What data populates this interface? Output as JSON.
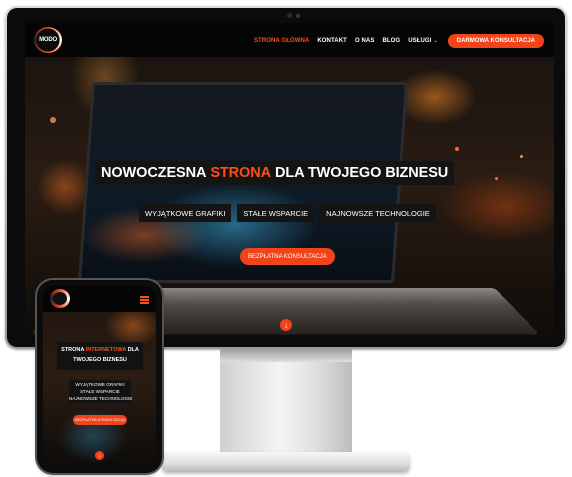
{
  "brand": {
    "logo_text": "MODO"
  },
  "nav": {
    "items": [
      {
        "label": "STRONA GŁÓWNA",
        "active": true
      },
      {
        "label": "KONTAKT"
      },
      {
        "label": "O NAS"
      },
      {
        "label": "BLOG"
      },
      {
        "label": "USŁUGI"
      }
    ],
    "cta": "DARMOWA KONSULTACJA"
  },
  "hero": {
    "title_before": "NOWOCZESNA",
    "title_accent": "STRONA",
    "title_after": "DLA TWOJEGO BIZNESU",
    "features": [
      "WYJĄTKOWE GRAFIKI",
      "STAŁE WSPARCIE",
      "NAJNOWSZE TECHNOLOGIE"
    ],
    "cta": "BEZPŁATNA KONSULTACJA"
  },
  "mobile": {
    "title_before": "STRONA",
    "title_accent": "INTERNETOWA",
    "title_mid": "DLA",
    "title_after": "TWOJEGO BIZNESU",
    "features": [
      "WYJĄTKOWE GRAFIKI",
      "STAŁE WSPARCIE",
      "NAJNOWSZE TECHNOLOGIE"
    ],
    "cta": "BEZPŁATNA KONSULTACJA"
  },
  "colors": {
    "accent": "#f2441b",
    "nav_bg": "#050505",
    "text": "#ffffff"
  },
  "icons": {
    "scroll": "arrow-down-icon",
    "menu": "hamburger-menu-icon",
    "dropdown": "chevron-down-icon"
  }
}
